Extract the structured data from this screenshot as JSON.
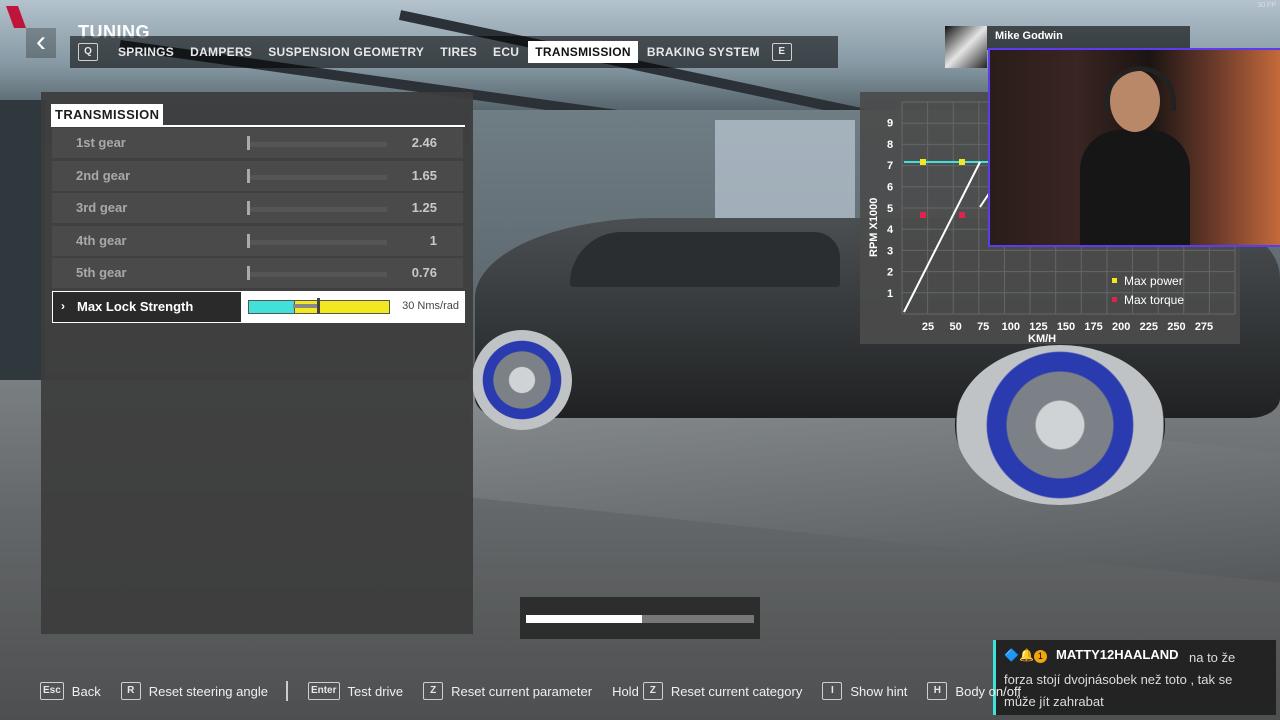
{
  "header": {
    "title": "TUNING",
    "prev_key": "Q",
    "next_key": "E",
    "tabs": [
      {
        "label": "SPRINGS",
        "active": false
      },
      {
        "label": "DAMPERS",
        "active": false
      },
      {
        "label": "SUSPENSION GEOMETRY",
        "active": false
      },
      {
        "label": "TIRES",
        "active": false
      },
      {
        "label": "ECU",
        "active": false
      },
      {
        "label": "TRANSMISSION",
        "active": true
      },
      {
        "label": "BRAKING SYSTEM",
        "active": false
      }
    ],
    "fps_text": "30 FP"
  },
  "panel": {
    "title": "TRANSMISSION",
    "rows": [
      {
        "label": "1st gear",
        "value": "2.46"
      },
      {
        "label": "2nd gear",
        "value": "1.65"
      },
      {
        "label": "3rd gear",
        "value": "1.25"
      },
      {
        "label": "4th gear",
        "value": "1"
      },
      {
        "label": "5th gear",
        "value": "0.76"
      }
    ],
    "selected_row": {
      "label": "Max Lock Strength",
      "value": "30 Nms/rad",
      "marker_glyph": "›"
    }
  },
  "center_progress": 0.51,
  "graph": {
    "y_label": "RPM X1000",
    "x_label": "KM/H",
    "y_ticks": [
      "1",
      "2",
      "3",
      "4",
      "5",
      "6",
      "7",
      "8",
      "9"
    ],
    "x_ticks": [
      "25",
      "50",
      "75",
      "100",
      "125",
      "150",
      "175",
      "200",
      "225",
      "250",
      "275"
    ],
    "legend": [
      {
        "label": "Max power",
        "color": "#f2e821"
      },
      {
        "label": "Max torque",
        "color": "#e0234a"
      }
    ],
    "colors": {
      "power_line": "#41e0da",
      "curve": "#ffffff"
    }
  },
  "stream": {
    "streamer_name": "Mike Godwin",
    "chat": {
      "username": "MATTY12HAALAND",
      "message": "na to že forza stojí dvojnásobek než toto , tak se může jít zahrabat",
      "badges": [
        "🔷",
        "🔔",
        "1"
      ]
    }
  },
  "hints": [
    {
      "key": "Esc",
      "label": "Back"
    },
    {
      "key": "R",
      "label": "Reset steering angle"
    },
    {
      "key": "Enter",
      "label": "Test drive"
    },
    {
      "key": "Z",
      "label": "Reset current parameter"
    },
    {
      "prefix": "Hold",
      "key": "Z",
      "label": "Reset current category"
    },
    {
      "key": "I",
      "label": "Show hint"
    },
    {
      "key": "H",
      "label": "Body on/off"
    }
  ]
}
